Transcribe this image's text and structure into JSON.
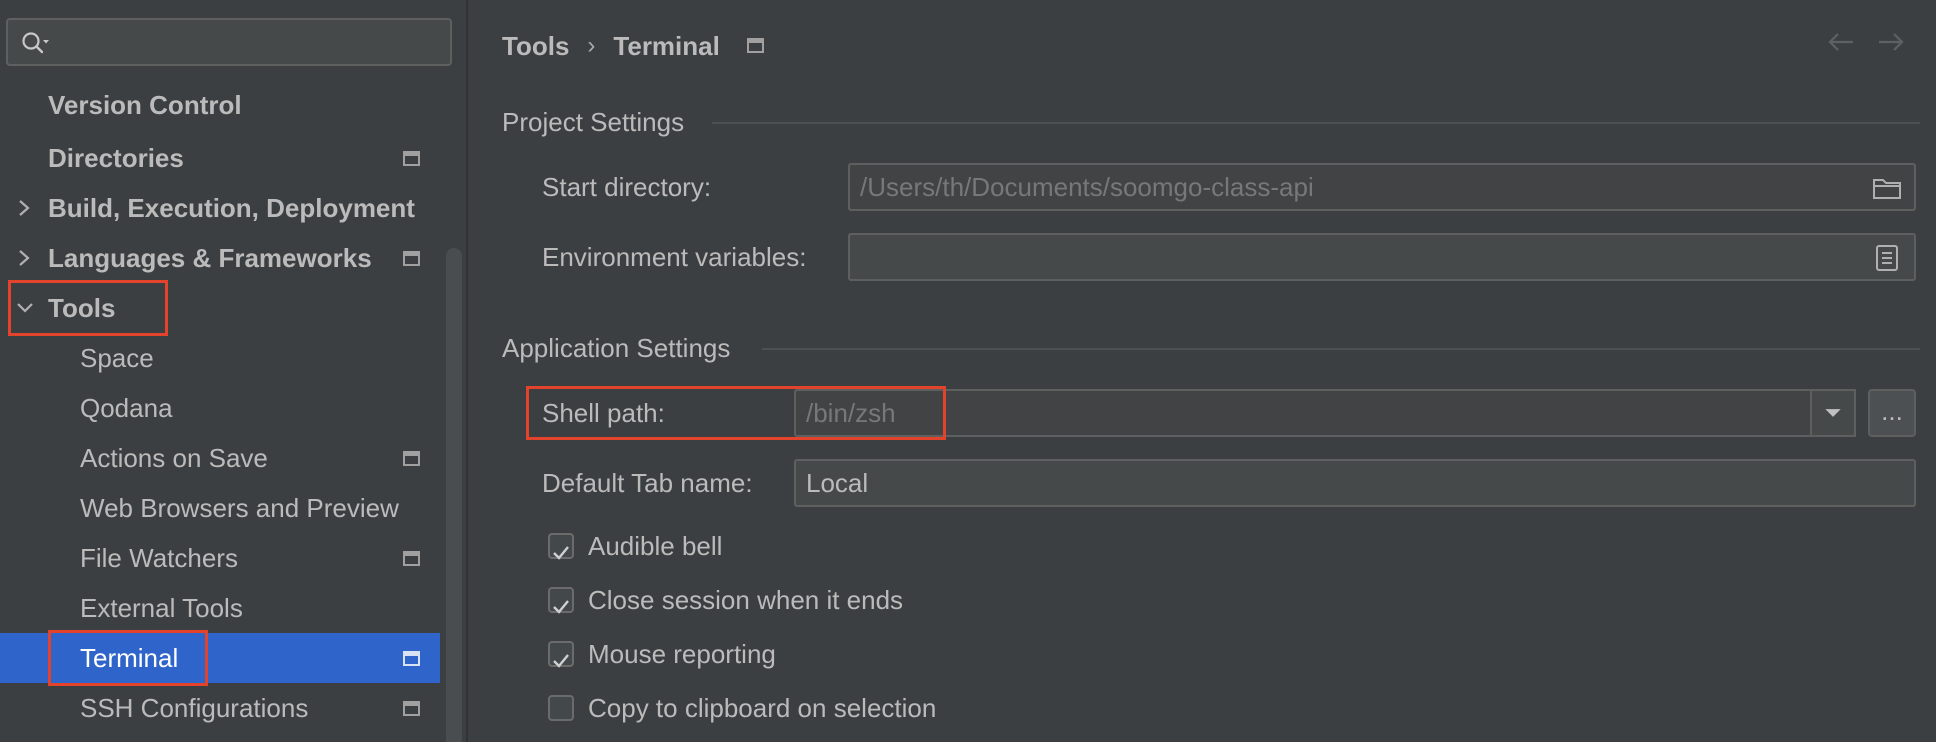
{
  "sidebar": {
    "search": {
      "placeholder": ""
    },
    "items": [
      {
        "label": "Version Control",
        "bold": true
      },
      {
        "label": "Directories",
        "bold": true
      },
      {
        "label": "Build, Execution, Deployment",
        "bold": true
      },
      {
        "label": "Languages & Frameworks",
        "bold": true
      },
      {
        "label": "Tools",
        "bold": true
      },
      {
        "label": "Space"
      },
      {
        "label": "Qodana"
      },
      {
        "label": "Actions on Save"
      },
      {
        "label": "Web Browsers and Preview"
      },
      {
        "label": "File Watchers"
      },
      {
        "label": "External Tools"
      },
      {
        "label": "Terminal",
        "selected": true
      },
      {
        "label": "SSH Configurations"
      }
    ]
  },
  "breadcrumb": {
    "parent": "Tools",
    "separator": "›",
    "current": "Terminal"
  },
  "project_settings": {
    "title": "Project Settings",
    "start_directory": {
      "label": "Start directory:",
      "value": "/Users/th/Documents/soomgo-class-api"
    },
    "env_vars": {
      "label": "Environment variables:",
      "value": ""
    }
  },
  "application_settings": {
    "title": "Application Settings",
    "shell_path": {
      "label": "Shell path:",
      "value": "/bin/zsh",
      "more_label": "..."
    },
    "default_tab_name": {
      "label": "Default Tab name:",
      "value": "Local"
    },
    "checkboxes": [
      {
        "label": "Audible bell",
        "checked": true
      },
      {
        "label": "Close session when it ends",
        "checked": true
      },
      {
        "label": "Mouse reporting",
        "checked": true
      },
      {
        "label": "Copy to clipboard on selection",
        "checked": false
      }
    ]
  },
  "colors": {
    "background": "#3c3f41",
    "selection": "#2f65ca",
    "highlight": "#e2432a"
  }
}
